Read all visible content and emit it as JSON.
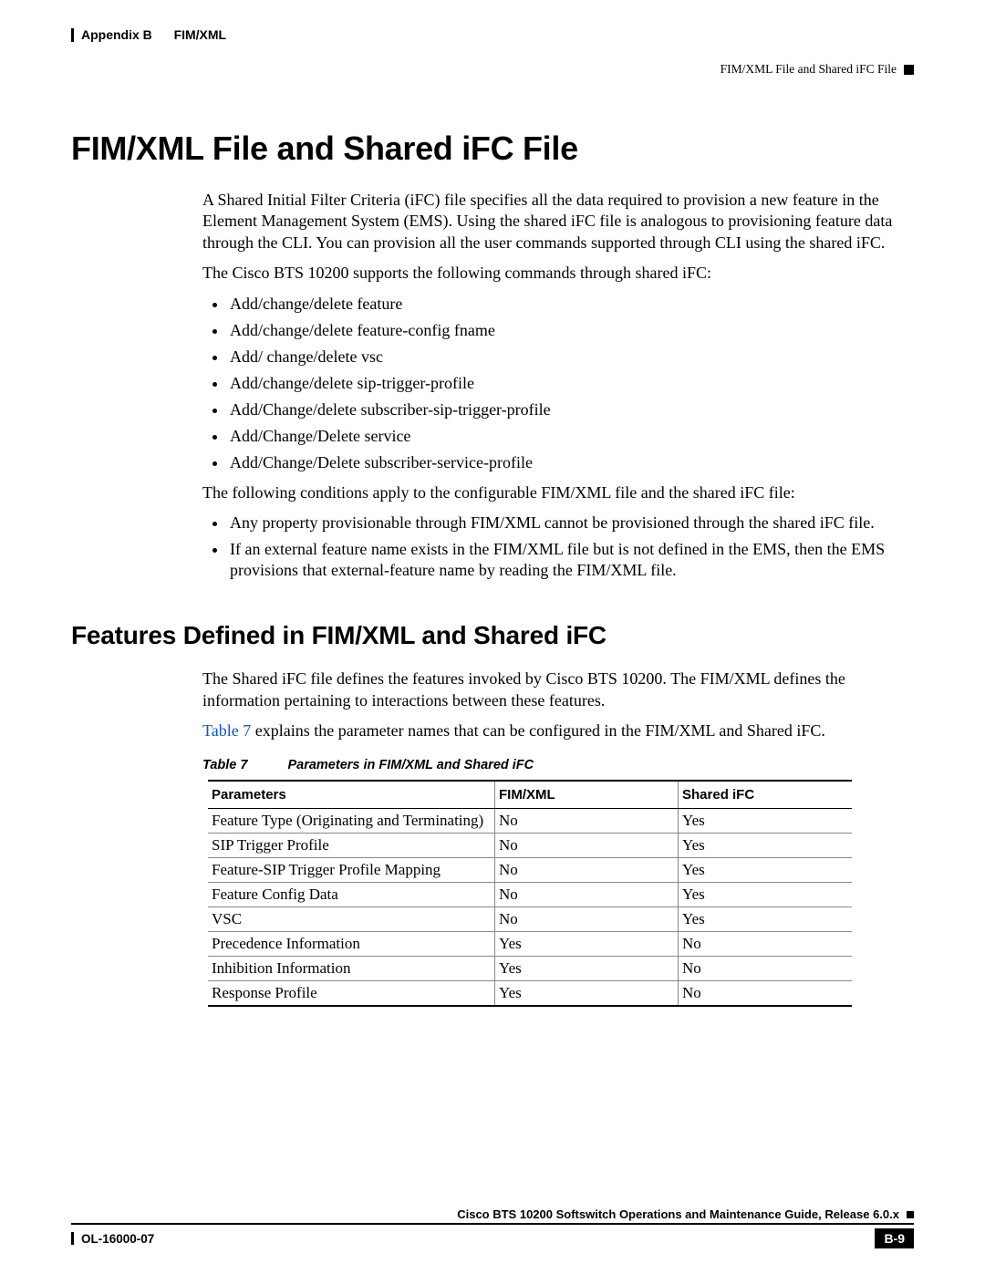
{
  "header": {
    "appendix": "Appendix B",
    "appendix_title": "FIM/XML",
    "section_title": "FIM/XML File and Shared iFC File"
  },
  "h1": "FIM/XML File and Shared iFC File",
  "p1": "A Shared Initial Filter Criteria (iFC) file specifies all the data required to provision a new feature in the Element Management System (EMS). Using the shared iFC file is analogous to provisioning feature data through the CLI. You can provision all the user commands supported through CLI using the shared iFC.",
  "p2": "The Cisco BTS 10200 supports the following commands through shared iFC:",
  "list1": [
    "Add/change/delete feature",
    "Add/change/delete feature-config fname",
    "Add/ change/delete vsc",
    "Add/change/delete sip-trigger-profile",
    "Add/Change/delete subscriber-sip-trigger-profile",
    "Add/Change/Delete service",
    "Add/Change/Delete subscriber-service-profile"
  ],
  "p3": "The following conditions apply to the configurable FIM/XML file and the shared iFC file:",
  "list2": [
    "Any property provisionable through FIM/XML cannot be provisioned through the shared iFC file.",
    "If an external feature name exists in the FIM/XML file but is not defined in the EMS, then the EMS provisions that external-feature name by reading the FIM/XML file."
  ],
  "h2": "Features Defined in FIM/XML and Shared iFC",
  "p4": "The Shared iFC file defines the features invoked by Cisco BTS 10200. The FIM/XML defines the information pertaining to interactions between these features.",
  "p5a": "Table 7",
  "p5b": " explains the parameter names that can be configured in the FIM/XML and Shared iFC.",
  "table": {
    "caption_num": "Table 7",
    "caption_txt": "Parameters in FIM/XML and Shared iFC",
    "headers": [
      "Parameters",
      "FIM/XML",
      "Shared iFC"
    ],
    "rows": [
      [
        "Feature Type (Originating and Terminating)",
        "No",
        "Yes"
      ],
      [
        "SIP Trigger Profile",
        "No",
        "Yes"
      ],
      [
        "Feature-SIP Trigger Profile Mapping",
        "No",
        "Yes"
      ],
      [
        "Feature Config Data",
        "No",
        "Yes"
      ],
      [
        "VSC",
        "No",
        "Yes"
      ],
      [
        "Precedence Information",
        "Yes",
        "No"
      ],
      [
        "Inhibition Information",
        "Yes",
        "No"
      ],
      [
        "Response Profile",
        "Yes",
        "No"
      ]
    ]
  },
  "footer": {
    "guide": "Cisco BTS 10200 Softswitch Operations and Maintenance Guide, Release 6.0.x",
    "docnum": "OL-16000-07",
    "pagenum": "B-9"
  }
}
